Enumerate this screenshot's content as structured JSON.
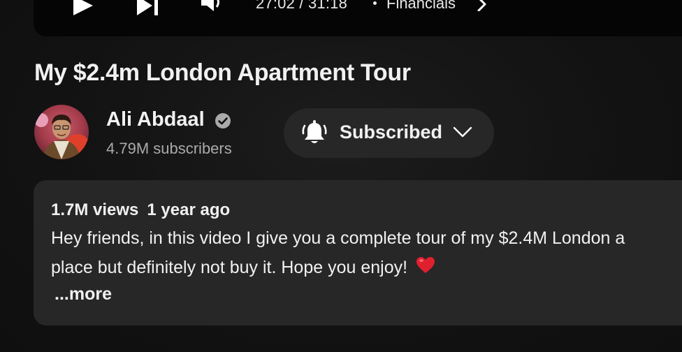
{
  "player": {
    "time": "27:02 / 31:18",
    "chapter": "Financials",
    "icons": [
      "play-icon",
      "next-icon",
      "volume-icon",
      "chevron-right-icon"
    ]
  },
  "video": {
    "title": "My $2.4m London Apartment Tour"
  },
  "channel": {
    "name": "Ali Abdaal",
    "subscribers": "4.79M subscribers",
    "verified_icon": "verified-check-icon"
  },
  "subscribe_button": {
    "label": "Subscribed",
    "icons": [
      "bell-icon",
      "chevron-down-icon"
    ]
  },
  "description": {
    "views": "1.7M views",
    "age": "1 year ago",
    "line1": "Hey friends, in this video I give you a complete tour of my $2.4M London a",
    "line2": "place but definitely not buy it. Hope you enjoy!",
    "emoji": "heart-emoji",
    "more_label": "...more"
  },
  "colors": {
    "background": "#0f0f0f",
    "surface": "#272727",
    "text_primary": "#f1f1f1",
    "text_secondary": "#aaaaaa",
    "heart": "#e0202e"
  }
}
